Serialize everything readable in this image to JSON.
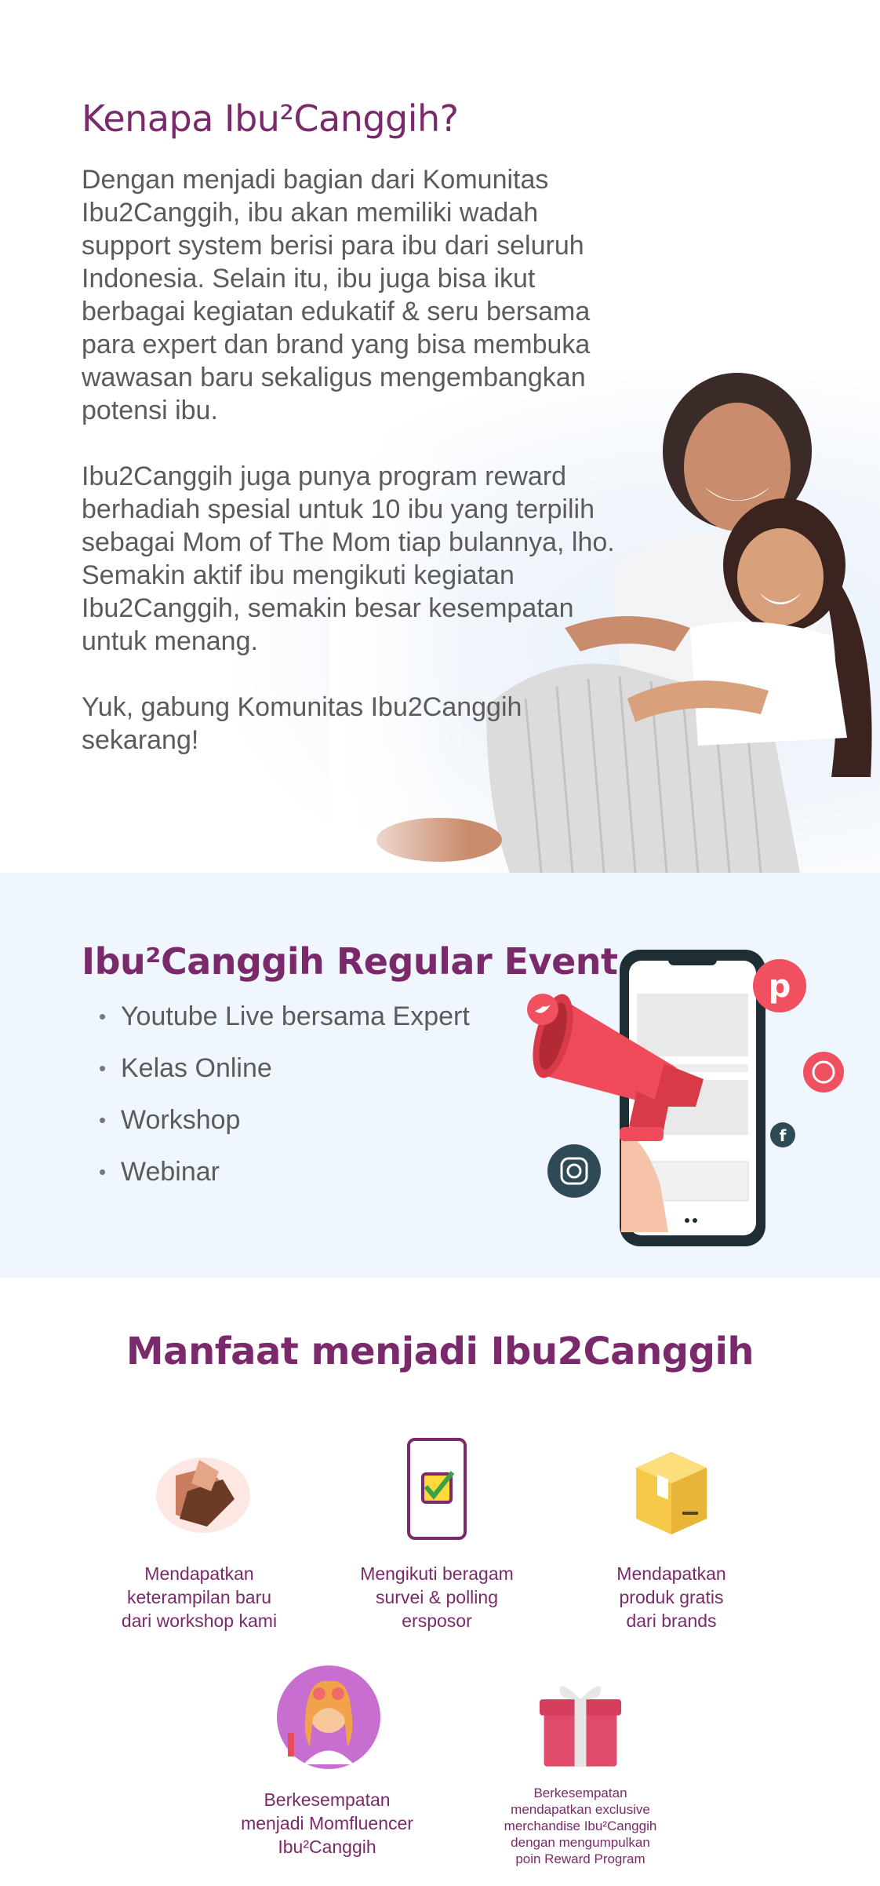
{
  "why": {
    "title": "Kenapa Ibu²Canggih?",
    "paragraphs": [
      "Dengan menjadi bagian dari Komunitas Ibu2Canggih, ibu akan memiliki wadah support system berisi para ibu dari seluruh Indonesia. Selain itu, ibu juga bisa ikut berbagai kegiatan edukatif & seru bersama para expert dan brand yang bisa membuka wawasan baru sekaligus mengembangkan potensi ibu.",
      "Ibu2Canggih juga punya program reward berhadiah spesial untuk 10 ibu yang terpilih sebagai Mom of The Mom tiap bulannya, lho. Semakin aktif ibu mengikuti kegiatan Ibu2Canggih, semakin besar kesempatan untuk menang.",
      "Yuk, gabung Komunitas Ibu2Canggih sekarang!"
    ]
  },
  "event": {
    "title": "Ibu²Canggih Regular Event",
    "items": [
      "Youtube Live bersama Expert",
      "Kelas Online",
      "Workshop",
      "Webinar"
    ]
  },
  "benefit": {
    "title": "Manfaat menjadi Ibu2Canggih",
    "cards": [
      {
        "icon": "hands-icon",
        "caption": "Mendapatkan\nketerampilan baru\ndari workshop kami"
      },
      {
        "icon": "survey-phone-icon",
        "caption": "Mengikuti beragam\nsurvei & polling\bersposor"
      },
      {
        "icon": "box-icon",
        "caption": "Mendapatkan\nproduk gratis\ndari brands"
      },
      {
        "icon": "momfluencer-icon",
        "caption": "Berkesempatan\nmenjadi Momfluencer\nIbu²Canggih"
      },
      {
        "icon": "gift-icon",
        "caption": "Berkesempatan\nmendapatkan exclusive\nmerchandise Ibu²Canggih\ndengan mengumpulkan\npoin Reward Program"
      }
    ]
  },
  "colors": {
    "accent": "#7a2a6b",
    "text": "#5b5b5b",
    "event_bg": "#f0f6fd",
    "megaphone": "#ef4b5a",
    "social_red": "#f05060",
    "social_dark": "#2f4a57"
  }
}
